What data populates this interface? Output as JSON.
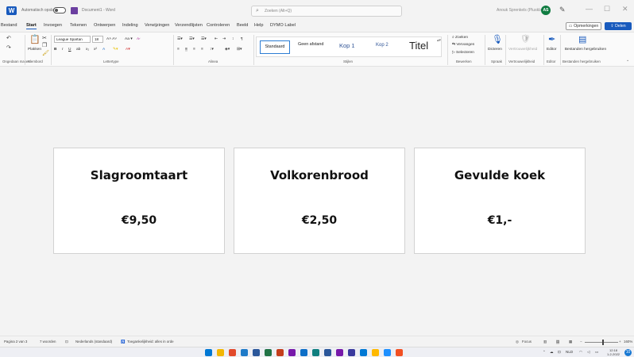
{
  "titlebar": {
    "autosave_label": "Automatisch opslaan",
    "document_name": "Document1 - Word",
    "search_placeholder": "Zoeken (Alt+Q)",
    "user_name": "Anouk Sprenkels (Plusklasse)",
    "avatar_initials": "AS"
  },
  "menu": {
    "items": [
      "Bestand",
      "Start",
      "Invoegen",
      "Tekenen",
      "Ontwerpen",
      "Indeling",
      "Verwijzingen",
      "Verzendlijsten",
      "Controleren",
      "Beeld",
      "Help",
      "DYMO Label"
    ],
    "active": "Start",
    "comments_label": "Opmerkingen",
    "share_label": "Delen"
  },
  "ribbon": {
    "undo_group": "Ongedaan maken",
    "clipboard_group": "Klembord",
    "paste_label": "Plakken",
    "font_name": "League Spartan",
    "font_size": "18",
    "font_group": "Lettertype",
    "paragraph_group": "Alinea",
    "styles": [
      "Standaard",
      "Geen afstand",
      "Kop 1",
      "Kop 2",
      "Titel"
    ],
    "styles_group": "Stijlen",
    "edit_items": [
      "Zoeken",
      "Vervangen",
      "Selecteren"
    ],
    "edit_group": "Bewerken",
    "dictate_label": "Dicteren",
    "speech_group": "Spraak",
    "sensitivity_label": "Vertrouwelijkheid",
    "sensitivity_group": "Vertrouwelijkheid",
    "editor_label": "Editor",
    "editor_group": "Editor",
    "reuse_label": "Bestanden hergebruiken",
    "reuse_group": "Bestanden hergebruiken"
  },
  "cards": [
    {
      "title": "Slagroomtaart",
      "price": "€9,50"
    },
    {
      "title": "Volkorenbrood",
      "price": "€2,50"
    },
    {
      "title": "Gevulde koek",
      "price": "€1,-"
    }
  ],
  "statusbar": {
    "page": "Pagina 2 van 3",
    "words": "7 woorden",
    "language": "Nederlands (standaard)",
    "accessibility": "Toegankelijkheid: alles in orde",
    "focus": "Focus",
    "zoom": "160%"
  },
  "taskbar": {
    "language": "NLD",
    "time": "12:18",
    "date": "1-2-2022",
    "notifications": "10",
    "app_colors": [
      "#0078d4",
      "#f2b705",
      "#e24a2b",
      "#1e7ac8",
      "#2b579a",
      "#217346",
      "#c43e1c",
      "#7719aa",
      "#0d6ec7",
      "#0f7f7f",
      "#2b579a",
      "#7719aa",
      "#3a3a9e",
      "#0078d4",
      "#ffb900",
      "#1e90ff",
      "#f25022"
    ]
  }
}
